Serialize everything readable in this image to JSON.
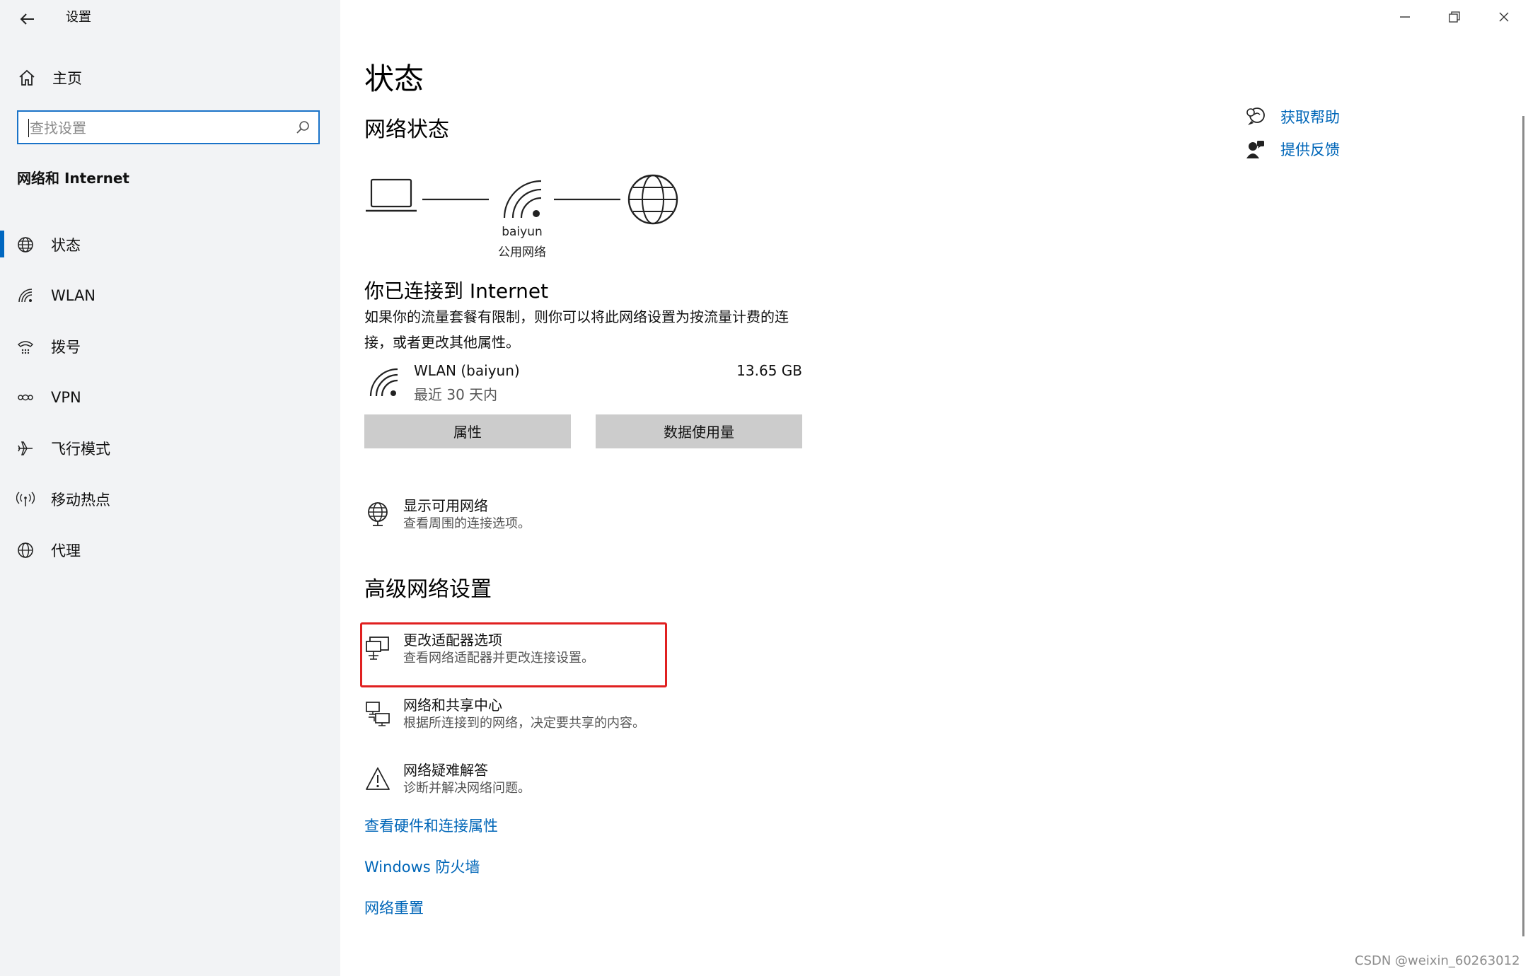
{
  "window": {
    "title": "设置",
    "controls": {
      "minimize": "—",
      "restore": "❐",
      "close": "✕"
    }
  },
  "sidebar": {
    "home_label": "主页",
    "search_placeholder": "查找设置",
    "section_title": "网络和 Internet",
    "items": [
      {
        "label": "状态",
        "icon": "status-globe-icon",
        "active": true
      },
      {
        "label": "WLAN",
        "icon": "wifi-icon",
        "active": false
      },
      {
        "label": "拨号",
        "icon": "dialup-icon",
        "active": false
      },
      {
        "label": "VPN",
        "icon": "vpn-icon",
        "active": false
      },
      {
        "label": "飞行模式",
        "icon": "airplane-icon",
        "active": false
      },
      {
        "label": "移动热点",
        "icon": "hotspot-icon",
        "active": false
      },
      {
        "label": "代理",
        "icon": "proxy-globe-icon",
        "active": false
      }
    ]
  },
  "main": {
    "page_title": "状态",
    "network_status_heading": "网络状态",
    "diagram": {
      "network_name": "baiyun",
      "network_type": "公用网络"
    },
    "connected_heading": "你已连接到 Internet",
    "connected_desc": "如果你的流量套餐有限制，则你可以将此网络设置为按流量计费的连接，或者更改其他属性。",
    "connection": {
      "name": "WLAN (baiyun)",
      "period": "最近 30 天内",
      "usage": "13.65 GB"
    },
    "buttons": {
      "properties": "属性",
      "data_usage": "数据使用量"
    },
    "show_networks": {
      "title": "显示可用网络",
      "desc": "查看周围的连接选项。"
    },
    "advanced_heading": "高级网络设置",
    "advanced": [
      {
        "title": "更改适配器选项",
        "desc": "查看网络适配器并更改连接设置。"
      },
      {
        "title": "网络和共享中心",
        "desc": "根据所连接到的网络，决定要共享的内容。"
      },
      {
        "title": "网络疑难解答",
        "desc": "诊断并解决网络问题。"
      }
    ],
    "links": {
      "hardware": "查看硬件和连接属性",
      "firewall": "Windows 防火墙",
      "reset": "网络重置"
    }
  },
  "help": {
    "get_help": "获取帮助",
    "feedback": "提供反馈"
  },
  "watermark": "CSDN @weixin_60263012",
  "colors": {
    "accent": "#0067c0",
    "link": "#0066b8",
    "highlight": "#e02020",
    "button": "#cccccc",
    "sidebar": "#f2f3f5"
  }
}
